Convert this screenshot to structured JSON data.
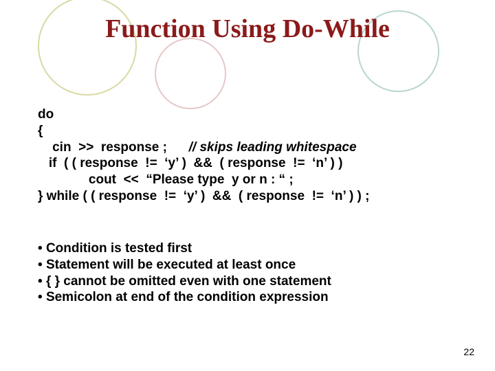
{
  "title": "Function Using Do-While",
  "code": {
    "l1": "do",
    "l2": "{",
    "l3a": "    cin  >>  response ;      ",
    "l3b": "// skips leading whitespace",
    "l4": "   if  ( ( response  !=  ‘y’ )  &&  ( response  !=  ‘n’ ) )",
    "l5": "              cout  <<  “Please type  y or n : “ ;",
    "l6": "} while ( ( response  !=  ‘y’ )  &&  ( response  !=  ‘n’ ) ) ;"
  },
  "bullets": {
    "b1": "Condition is tested first",
    "b2": "Statement will be executed at least once",
    "b3": "{ } cannot be omitted even with one statement",
    "b4": "Semicolon at end of the condition expression"
  },
  "page": "22"
}
